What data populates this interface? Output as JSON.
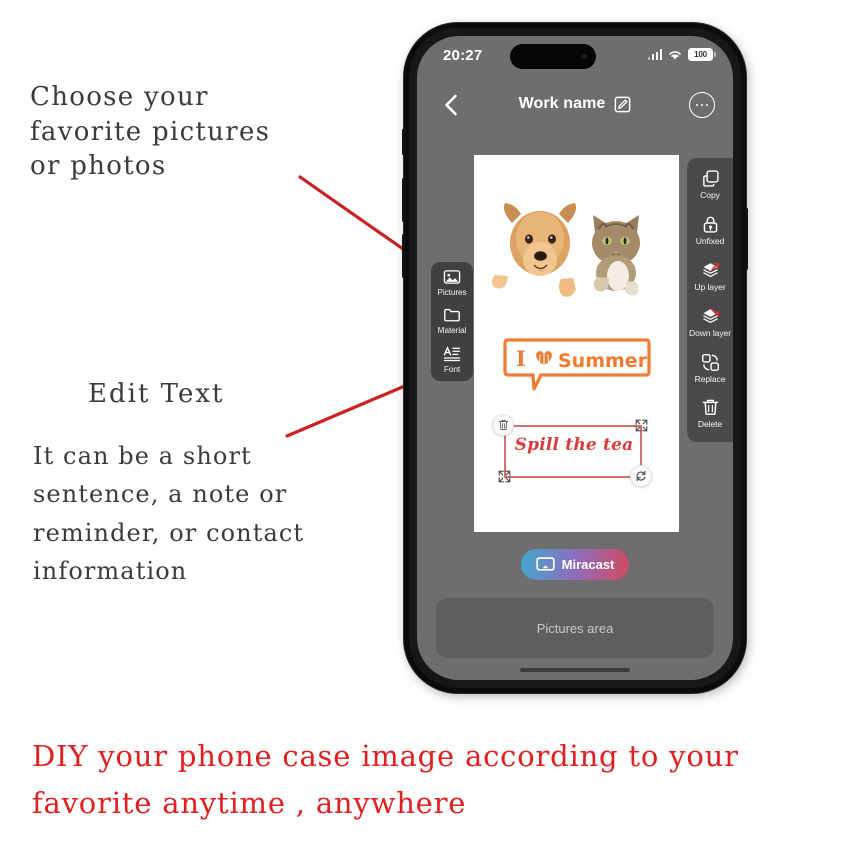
{
  "annotations": {
    "choose": "Choose your\nfavorite pictures\nor photos",
    "edit_title": "Edit Text",
    "edit_body": "It can be a short\nsentence, a note or\nreminder, or contact\ninformation",
    "bottom": "DIY your phone case image according to your\nfavorite anytime , anywhere"
  },
  "colors": {
    "annotation_text": "#3b3b3b",
    "bottom_text": "#e02020",
    "pointer_line": "#cc2020",
    "screen_bg": "#6e6e6e",
    "summer_orange": "#f07c33",
    "spill_red": "#d93b3b",
    "selection_line": "#d4706e"
  },
  "phone": {
    "status_bar": {
      "time": "20:27",
      "battery_level": "100",
      "signal_icon": "cellular-signal-icon",
      "wifi_icon": "wifi-icon",
      "battery_icon": "battery-icon"
    },
    "nav_bar": {
      "back_icon": "chevron-left-icon",
      "title": "Work name",
      "edit_icon": "edit-pencil-square-icon",
      "more_icon": "more-options-icon"
    },
    "left_rail": [
      {
        "label": "Pictures",
        "icon": "picture-image-icon"
      },
      {
        "label": "Material",
        "icon": "folder-material-icon"
      },
      {
        "label": "Font",
        "icon": "font-text-icon"
      }
    ],
    "right_rail": [
      {
        "label": "Copy",
        "icon": "copy-duplicate-icon"
      },
      {
        "label": "Unfixed",
        "icon": "unlock-padlock-icon"
      },
      {
        "label": "Up layer",
        "icon": "layer-up-icon"
      },
      {
        "label": "Down layer",
        "icon": "layer-down-icon"
      },
      {
        "label": "Replace",
        "icon": "replace-swap-icon"
      },
      {
        "label": "Delete",
        "icon": "trash-delete-icon"
      }
    ],
    "canvas": {
      "photo_alt": "dog-and-cat-photo",
      "sticker_text": "Summer",
      "sticker_prefix": "I",
      "sticker_heart": "heart-icon",
      "selected_text": "Spill the tea",
      "handles": {
        "delete": "trash-handle-icon",
        "resize_top_right": "resize-handle-icon",
        "resize_bottom_left": "resize-handle-icon",
        "rotate": "rotate-handle-icon"
      }
    },
    "miracast": {
      "label": "Miracast",
      "icon": "cast-screen-icon"
    },
    "pictures_area": {
      "label": "Pictures area"
    },
    "home_indicator": "home-indicator"
  }
}
